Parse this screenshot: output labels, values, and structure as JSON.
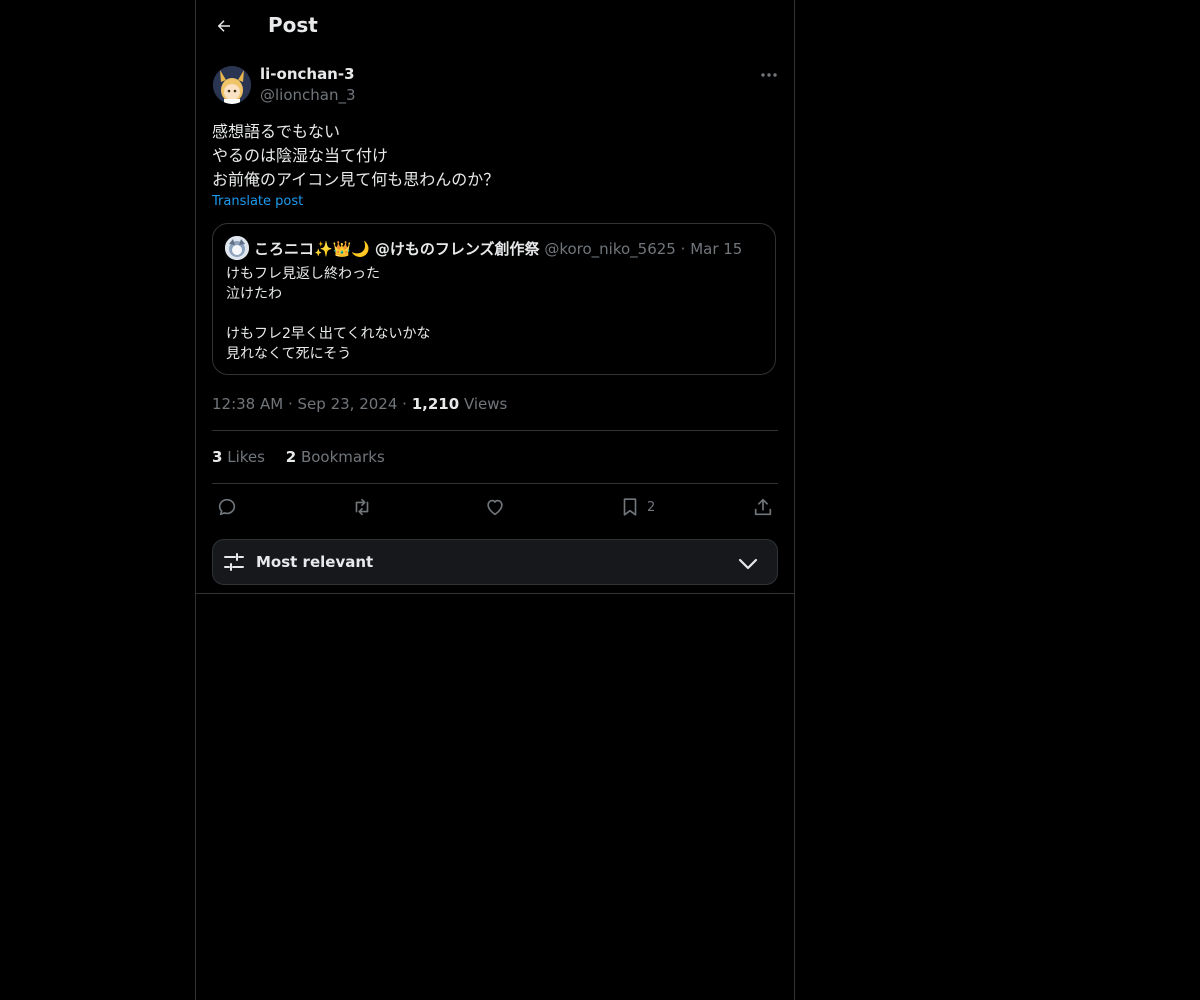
{
  "header": {
    "title": "Post"
  },
  "post": {
    "author_name": "li-onchan-3",
    "author_handle": "@lionchan_3",
    "lines": [
      "感想語るでもない",
      "やるのは陰湿な当て付け",
      "お前俺のアイコン見て何も思わんのか？"
    ],
    "translate_label": "Translate post",
    "time": "12:38 AM",
    "date": "Sep 23, 2024",
    "views_count": "1,210",
    "views_label": "Views"
  },
  "quote": {
    "name": "ころニコ",
    "name_emoji": "✨👑🌙",
    "name_suffix": "@けものフレンズ創作祭",
    "handle": "@koro_niko_5625",
    "date": "Mar 15",
    "lines": [
      "けもフレ見返し終わった",
      "泣けたわ",
      "",
      "けもフレ2早く出てくれないかな",
      "見れなくて死にそう"
    ]
  },
  "stats": {
    "likes_count": "3",
    "likes_label": "Likes",
    "bookmarks_count": "2",
    "bookmarks_label": "Bookmarks"
  },
  "actions": {
    "bookmark_count": "2"
  },
  "sort": {
    "label": "Most relevant"
  },
  "colors": {
    "background": "#000000",
    "text": "#e7e9ea",
    "muted": "#71767b",
    "link": "#1d9bf0",
    "border": "#2f3336"
  }
}
